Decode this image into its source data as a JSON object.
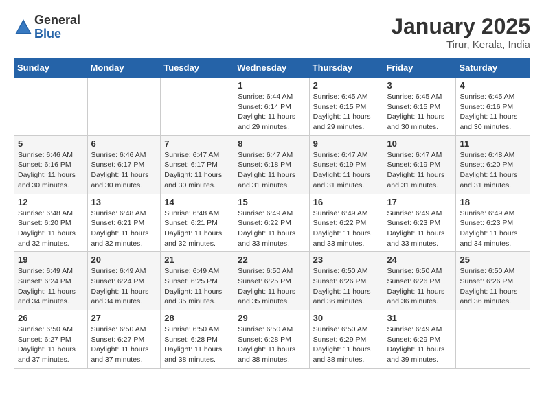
{
  "logo": {
    "general": "General",
    "blue": "Blue"
  },
  "header": {
    "month": "January 2025",
    "location": "Tirur, Kerala, India"
  },
  "weekdays": [
    "Sunday",
    "Monday",
    "Tuesday",
    "Wednesday",
    "Thursday",
    "Friday",
    "Saturday"
  ],
  "weeks": [
    [
      {
        "day": "",
        "info": ""
      },
      {
        "day": "",
        "info": ""
      },
      {
        "day": "",
        "info": ""
      },
      {
        "day": "1",
        "info": "Sunrise: 6:44 AM\nSunset: 6:14 PM\nDaylight: 11 hours\nand 29 minutes."
      },
      {
        "day": "2",
        "info": "Sunrise: 6:45 AM\nSunset: 6:15 PM\nDaylight: 11 hours\nand 29 minutes."
      },
      {
        "day": "3",
        "info": "Sunrise: 6:45 AM\nSunset: 6:15 PM\nDaylight: 11 hours\nand 30 minutes."
      },
      {
        "day": "4",
        "info": "Sunrise: 6:45 AM\nSunset: 6:16 PM\nDaylight: 11 hours\nand 30 minutes."
      }
    ],
    [
      {
        "day": "5",
        "info": "Sunrise: 6:46 AM\nSunset: 6:16 PM\nDaylight: 11 hours\nand 30 minutes."
      },
      {
        "day": "6",
        "info": "Sunrise: 6:46 AM\nSunset: 6:17 PM\nDaylight: 11 hours\nand 30 minutes."
      },
      {
        "day": "7",
        "info": "Sunrise: 6:47 AM\nSunset: 6:17 PM\nDaylight: 11 hours\nand 30 minutes."
      },
      {
        "day": "8",
        "info": "Sunrise: 6:47 AM\nSunset: 6:18 PM\nDaylight: 11 hours\nand 31 minutes."
      },
      {
        "day": "9",
        "info": "Sunrise: 6:47 AM\nSunset: 6:19 PM\nDaylight: 11 hours\nand 31 minutes."
      },
      {
        "day": "10",
        "info": "Sunrise: 6:47 AM\nSunset: 6:19 PM\nDaylight: 11 hours\nand 31 minutes."
      },
      {
        "day": "11",
        "info": "Sunrise: 6:48 AM\nSunset: 6:20 PM\nDaylight: 11 hours\nand 31 minutes."
      }
    ],
    [
      {
        "day": "12",
        "info": "Sunrise: 6:48 AM\nSunset: 6:20 PM\nDaylight: 11 hours\nand 32 minutes."
      },
      {
        "day": "13",
        "info": "Sunrise: 6:48 AM\nSunset: 6:21 PM\nDaylight: 11 hours\nand 32 minutes."
      },
      {
        "day": "14",
        "info": "Sunrise: 6:48 AM\nSunset: 6:21 PM\nDaylight: 11 hours\nand 32 minutes."
      },
      {
        "day": "15",
        "info": "Sunrise: 6:49 AM\nSunset: 6:22 PM\nDaylight: 11 hours\nand 33 minutes."
      },
      {
        "day": "16",
        "info": "Sunrise: 6:49 AM\nSunset: 6:22 PM\nDaylight: 11 hours\nand 33 minutes."
      },
      {
        "day": "17",
        "info": "Sunrise: 6:49 AM\nSunset: 6:23 PM\nDaylight: 11 hours\nand 33 minutes."
      },
      {
        "day": "18",
        "info": "Sunrise: 6:49 AM\nSunset: 6:23 PM\nDaylight: 11 hours\nand 34 minutes."
      }
    ],
    [
      {
        "day": "19",
        "info": "Sunrise: 6:49 AM\nSunset: 6:24 PM\nDaylight: 11 hours\nand 34 minutes."
      },
      {
        "day": "20",
        "info": "Sunrise: 6:49 AM\nSunset: 6:24 PM\nDaylight: 11 hours\nand 34 minutes."
      },
      {
        "day": "21",
        "info": "Sunrise: 6:49 AM\nSunset: 6:25 PM\nDaylight: 11 hours\nand 35 minutes."
      },
      {
        "day": "22",
        "info": "Sunrise: 6:50 AM\nSunset: 6:25 PM\nDaylight: 11 hours\nand 35 minutes."
      },
      {
        "day": "23",
        "info": "Sunrise: 6:50 AM\nSunset: 6:26 PM\nDaylight: 11 hours\nand 36 minutes."
      },
      {
        "day": "24",
        "info": "Sunrise: 6:50 AM\nSunset: 6:26 PM\nDaylight: 11 hours\nand 36 minutes."
      },
      {
        "day": "25",
        "info": "Sunrise: 6:50 AM\nSunset: 6:26 PM\nDaylight: 11 hours\nand 36 minutes."
      }
    ],
    [
      {
        "day": "26",
        "info": "Sunrise: 6:50 AM\nSunset: 6:27 PM\nDaylight: 11 hours\nand 37 minutes."
      },
      {
        "day": "27",
        "info": "Sunrise: 6:50 AM\nSunset: 6:27 PM\nDaylight: 11 hours\nand 37 minutes."
      },
      {
        "day": "28",
        "info": "Sunrise: 6:50 AM\nSunset: 6:28 PM\nDaylight: 11 hours\nand 38 minutes."
      },
      {
        "day": "29",
        "info": "Sunrise: 6:50 AM\nSunset: 6:28 PM\nDaylight: 11 hours\nand 38 minutes."
      },
      {
        "day": "30",
        "info": "Sunrise: 6:50 AM\nSunset: 6:29 PM\nDaylight: 11 hours\nand 38 minutes."
      },
      {
        "day": "31",
        "info": "Sunrise: 6:49 AM\nSunset: 6:29 PM\nDaylight: 11 hours\nand 39 minutes."
      },
      {
        "day": "",
        "info": ""
      }
    ]
  ]
}
